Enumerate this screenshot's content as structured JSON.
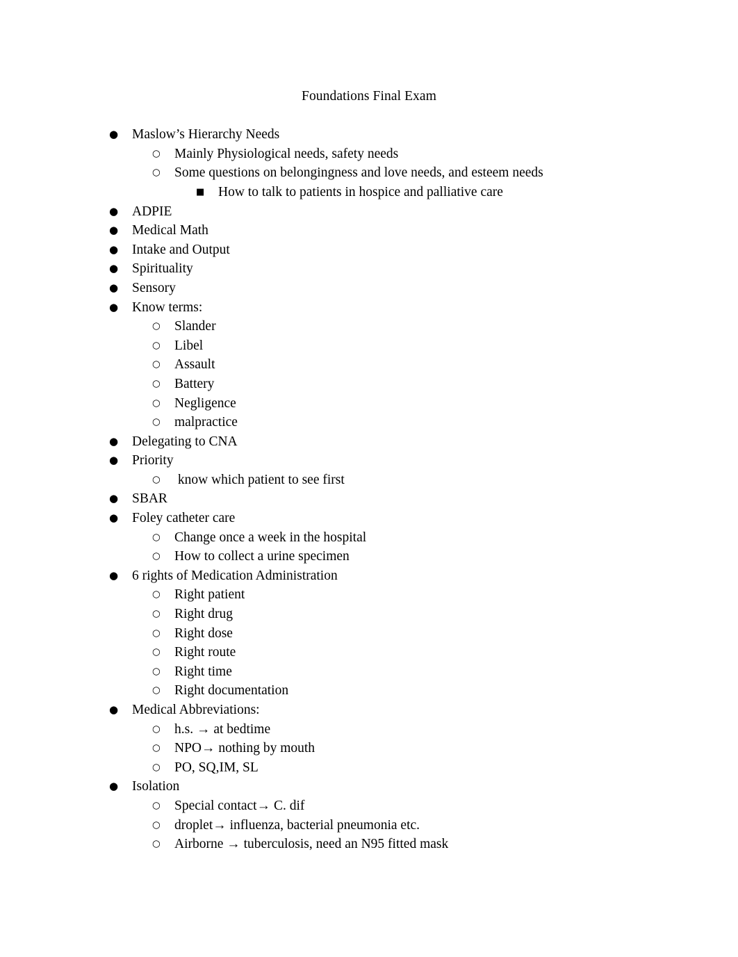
{
  "document": {
    "title": "Foundations Final Exam",
    "bullet_glyphs": {
      "level1": "●",
      "level2": "○",
      "level3": "■"
    },
    "colors": {
      "text": "#000000",
      "page_background": "#ffffff"
    },
    "outline": [
      {
        "level": 1,
        "text": "Maslow’s Hierarchy Needs"
      },
      {
        "level": 2,
        "text": "Mainly Physiological needs, safety needs"
      },
      {
        "level": 2,
        "text": "Some questions on belongingness and love needs, and esteem needs"
      },
      {
        "level": 3,
        "text": "How to talk to patients in hospice and palliative care"
      },
      {
        "level": 1,
        "text": "ADPIE"
      },
      {
        "level": 1,
        "text": "Medical Math"
      },
      {
        "level": 1,
        "text": "Intake and Output"
      },
      {
        "level": 1,
        "text": "Spirituality"
      },
      {
        "level": 1,
        "text": "Sensory"
      },
      {
        "level": 1,
        "text": "Know terms:"
      },
      {
        "level": 2,
        "text": "Slander"
      },
      {
        "level": 2,
        "text": "Libel"
      },
      {
        "level": 2,
        "text": "Assault"
      },
      {
        "level": 2,
        "text": "Battery"
      },
      {
        "level": 2,
        "text": "Negligence"
      },
      {
        "level": 2,
        "text": "malpractice"
      },
      {
        "level": 1,
        "text": "Delegating to CNA"
      },
      {
        "level": 1,
        "text": "Priority"
      },
      {
        "level": 2,
        "text": " know which patient to see first"
      },
      {
        "level": 1,
        "text": "SBAR"
      },
      {
        "level": 1,
        "text": "Foley catheter care"
      },
      {
        "level": 2,
        "text": "Change once a week in the hospital"
      },
      {
        "level": 2,
        "text": "How to collect a urine specimen"
      },
      {
        "level": 1,
        "text": "6 rights of Medication Administration"
      },
      {
        "level": 2,
        "text": "Right patient"
      },
      {
        "level": 2,
        "text": "Right drug"
      },
      {
        "level": 2,
        "text": "Right dose"
      },
      {
        "level": 2,
        "text": "Right route"
      },
      {
        "level": 2,
        "text": "Right time"
      },
      {
        "level": 2,
        "text": "Right documentation"
      },
      {
        "level": 1,
        "text": "Medical Abbreviations:"
      },
      {
        "level": 2,
        "text": "h.s. → at bedtime"
      },
      {
        "level": 2,
        "text": "NPO→ nothing by mouth"
      },
      {
        "level": 2,
        "text": "PO, SQ,IM, SL"
      },
      {
        "level": 1,
        "text": "Isolation"
      },
      {
        "level": 2,
        "text": "Special contact→ C. dif"
      },
      {
        "level": 2,
        "text": "droplet→ influenza, bacterial pneumonia etc."
      },
      {
        "level": 2,
        "text": "Airborne → tuberculosis, need an N95 fitted mask"
      }
    ]
  }
}
